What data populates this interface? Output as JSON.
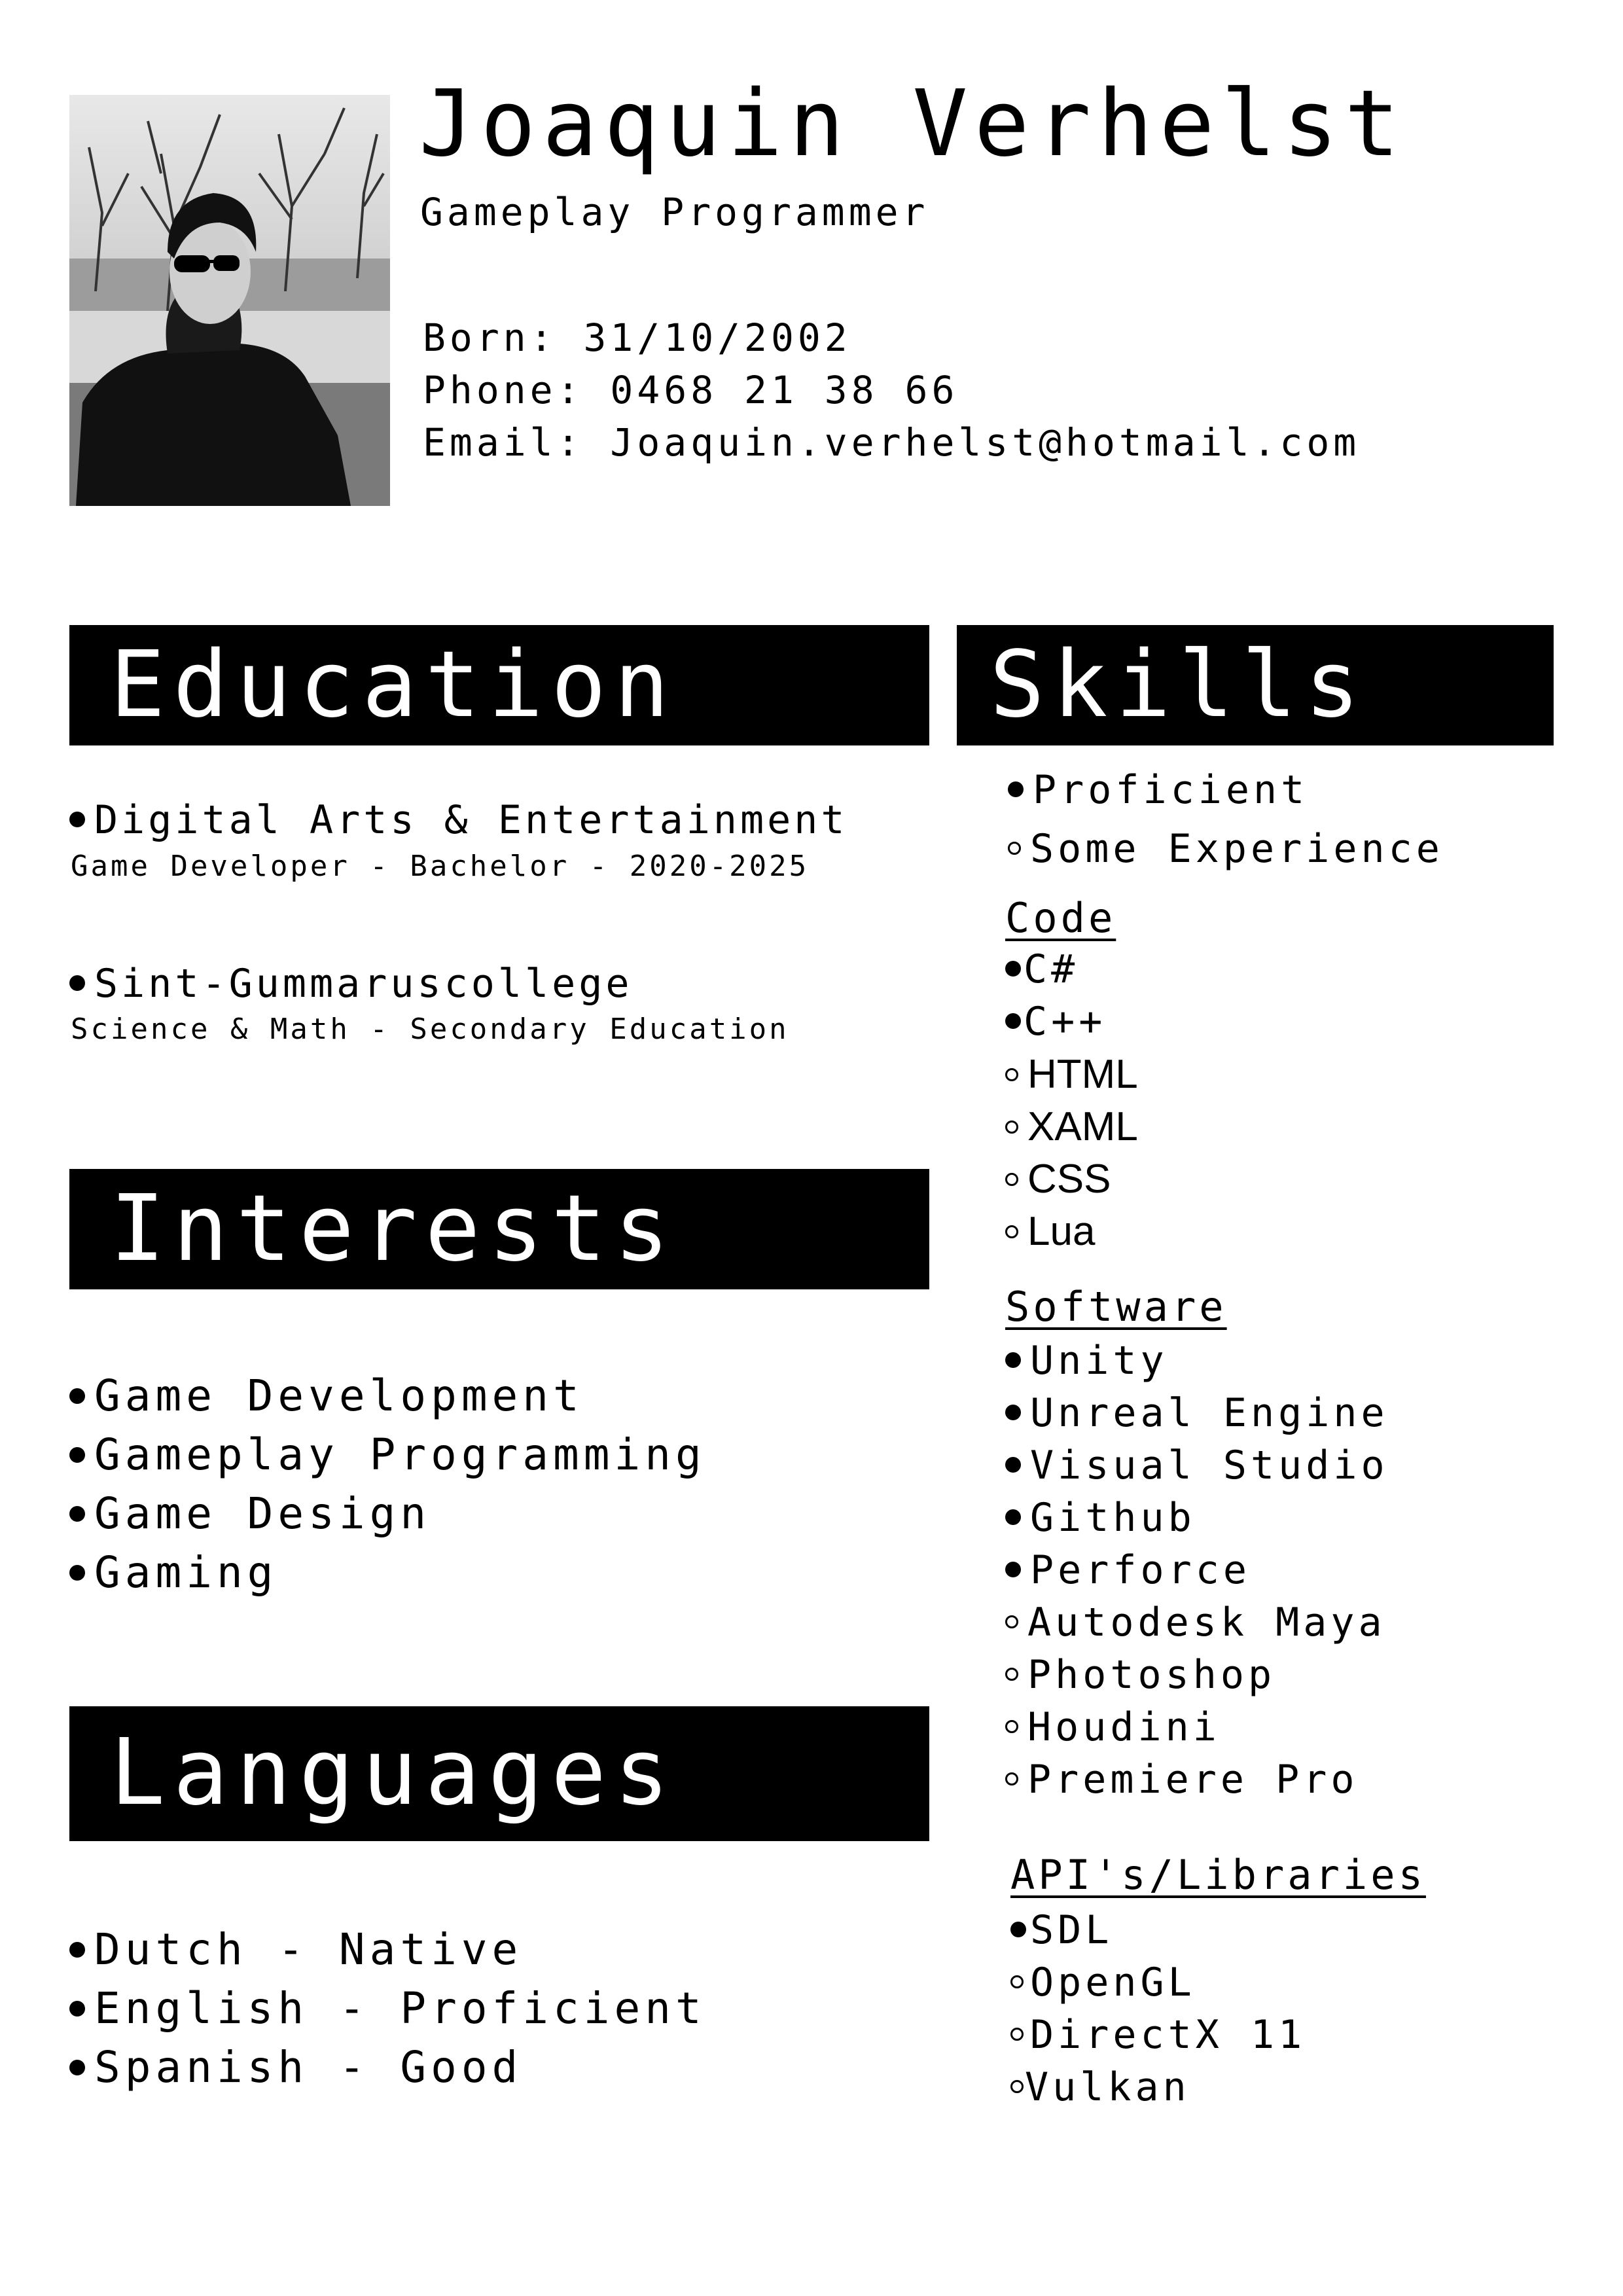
{
  "header": {
    "name": "Joaquin Verhelst",
    "role": "Gameplay Programmer",
    "born": "Born: 31/10/2002",
    "phone": "Phone: 0468 21 38 66",
    "email": "Email: Joaquin.verhelst@hotmail.com"
  },
  "education": {
    "title": "Education",
    "items": [
      {
        "name": "Digital Arts & Entertainment",
        "detail": "Game Developer - Bachelor - 2020-2025"
      },
      {
        "name": "Sint-Gummaruscollege",
        "detail": "Science & Math - Secondary Education"
      }
    ]
  },
  "interests": {
    "title": "Interests",
    "items": [
      "Game Development",
      "Gameplay Programming",
      "Game Design",
      "Gaming"
    ]
  },
  "languages": {
    "title": "Languages",
    "items": [
      "Dutch - Native",
      "English - Proficient",
      "Spanish - Good"
    ]
  },
  "skills": {
    "title": "Skills",
    "legend": {
      "proficient": "Proficient",
      "some": "Some Experience"
    },
    "code": {
      "heading": "Code",
      "items": [
        {
          "label": "C#",
          "level": "proficient"
        },
        {
          "label": "C++",
          "level": "proficient"
        },
        {
          "label": "HTML",
          "level": "some"
        },
        {
          "label": "XAML",
          "level": "some"
        },
        {
          "label": "CSS",
          "level": "some"
        },
        {
          "label": "Lua",
          "level": "some"
        }
      ]
    },
    "software": {
      "heading": "Software",
      "items": [
        {
          "label": "Unity",
          "level": "proficient"
        },
        {
          "label": "Unreal Engine",
          "level": "proficient"
        },
        {
          "label": "Visual Studio",
          "level": "proficient"
        },
        {
          "label": "Github",
          "level": "proficient"
        },
        {
          "label": "Perforce",
          "level": "proficient"
        },
        {
          "label": "Autodesk Maya",
          "level": "some"
        },
        {
          "label": "Photoshop",
          "level": "some"
        },
        {
          "label": "Houdini",
          "level": "some"
        },
        {
          "label": "Premiere Pro",
          "level": "some"
        }
      ]
    },
    "apis": {
      "heading": "API's/Libraries",
      "items": [
        {
          "label": "SDL",
          "level": "proficient"
        },
        {
          "label": "OpenGL",
          "level": "some"
        },
        {
          "label": "DirectX 11",
          "level": "some"
        },
        {
          "label": "Vulkan",
          "level": "some"
        }
      ]
    }
  }
}
